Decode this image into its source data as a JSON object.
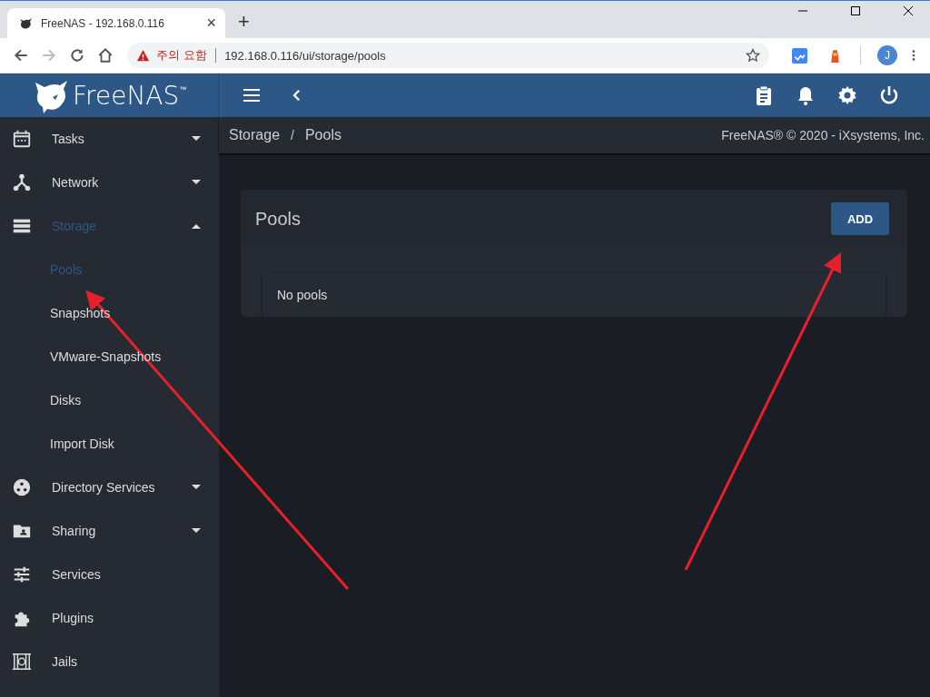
{
  "browser": {
    "tab_title": "FreeNAS - 192.168.0.116",
    "tab_close": "×",
    "new_tab": "+",
    "security_warning": "주의 요함",
    "url": "192.168.0.116/ui/storage/pools",
    "profile_initial": "J"
  },
  "app_header": {
    "logo_text": "FreeNAS$^{™}$"
  },
  "sidebar": {
    "items": [
      {
        "label": "Tasks",
        "expanded": false,
        "selected": false
      },
      {
        "label": "Network",
        "expanded": false,
        "selected": false
      },
      {
        "label": "Storage",
        "expanded": true,
        "selected": true,
        "children": [
          {
            "label": "Pools",
            "selected": true
          },
          {
            "label": "Snapshots",
            "selected": false
          },
          {
            "label": "VMware-Snapshots",
            "selected": false
          },
          {
            "label": "Disks",
            "selected": false
          },
          {
            "label": "Import Disk",
            "selected": false
          }
        ]
      },
      {
        "label": "Directory Services",
        "expanded": false,
        "selected": false
      },
      {
        "label": "Sharing",
        "expanded": false,
        "selected": false
      },
      {
        "label": "Services",
        "selected": false
      },
      {
        "label": "Plugins",
        "selected": false
      },
      {
        "label": "Jails",
        "selected": false
      }
    ]
  },
  "breadcrumb": [
    "Storage",
    "Pools"
  ],
  "breadcrumb_separator": "/",
  "copyright": "FreeNAS® © 2020 - iXsystems, Inc.",
  "card": {
    "title": "Pools",
    "button": "ADD",
    "empty_message": "No pools"
  }
}
